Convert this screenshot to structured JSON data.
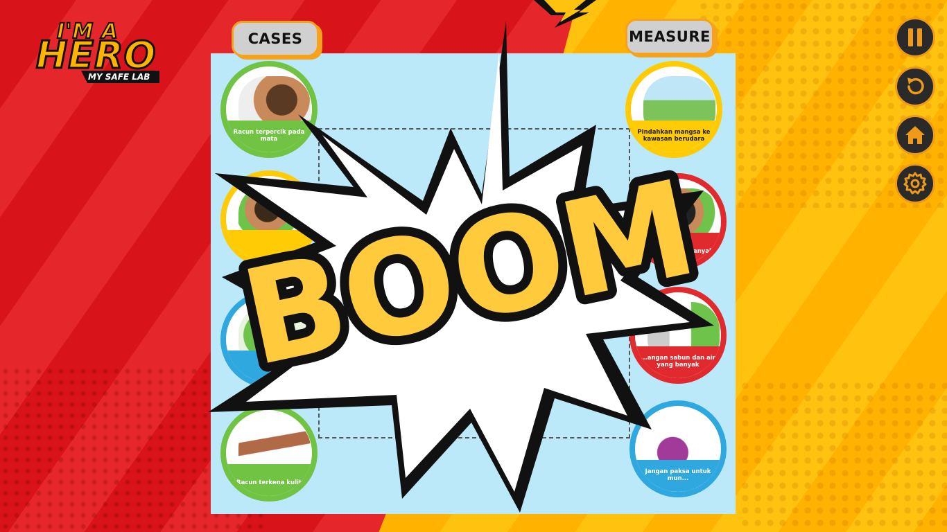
{
  "logo": {
    "top": "I'M A",
    "main": "HERO",
    "sub": "MY SAFE LAB"
  },
  "tabs": {
    "cases": "CASES",
    "measure": "MEASURE"
  },
  "cases": [
    {
      "label": "Racun terpercik pada mata",
      "ring": "green"
    },
    {
      "label": "",
      "ring": "yellow"
    },
    {
      "label": "",
      "ring": "blue"
    },
    {
      "label": "Racun terkena kulit",
      "ring": "green"
    }
  ],
  "measures": [
    {
      "label": "Pindahkan mangsa ke kawasan berudara",
      "ring": "yellow"
    },
    {
      "label": "...an air yang banyak",
      "ring": "red"
    },
    {
      "label": "...angan sabun dan air yang banyak",
      "ring": "red"
    },
    {
      "label": "Jangan paksa untuk mun...",
      "ring": "blue"
    }
  ],
  "effect": {
    "text": "BOOM"
  },
  "controls": [
    "pause-icon",
    "restart-icon",
    "home-icon",
    "settings-icon"
  ],
  "colors": {
    "accent": "#ef9a18",
    "red": "#d8141a",
    "yellow": "#ffc20e",
    "board": "#bbe9f9"
  }
}
